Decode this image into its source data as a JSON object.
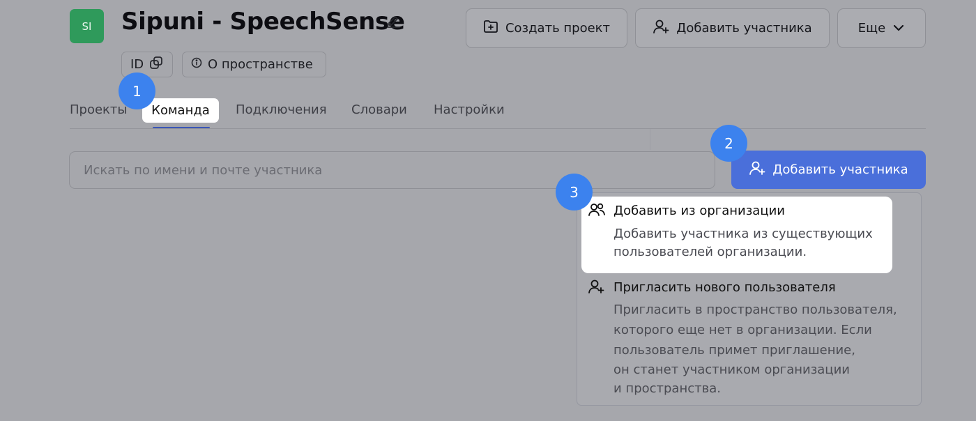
{
  "header": {
    "avatar_initials": "SI",
    "title": "Sipuni - SpeechSense",
    "id_chip": "ID",
    "about_chip": "О пространстве",
    "create_project": "Создать проект",
    "add_member": "Добавить участника",
    "more": "Еще"
  },
  "tabs": [
    "Проекты",
    "Команда",
    "Подключения",
    "Словари",
    "Настройки"
  ],
  "active_tab": "Команда",
  "search": {
    "placeholder": "Искать по имени и почте участника"
  },
  "primary_button": "Добавить участника",
  "menu": [
    {
      "icon": "users-icon",
      "title": "Добавить из организации",
      "description": [
        "Добавить участника из существующих",
        "пользователей организации."
      ]
    },
    {
      "icon": "user-plus-icon",
      "title": "Пригласить нового пользователя",
      "description": [
        "Пригласить в пространство пользователя,",
        "которого еще нет в организации. Если",
        "пользователь примет приглашение,",
        "он станет участником организации",
        "и пространства."
      ]
    }
  ],
  "steps": [
    "1",
    "2",
    "3"
  ],
  "colors": {
    "accent": "#4a6fda",
    "step_marker": "#3c82ee",
    "avatar": "#2f9a5b",
    "overlay": "#a6a7ac"
  }
}
